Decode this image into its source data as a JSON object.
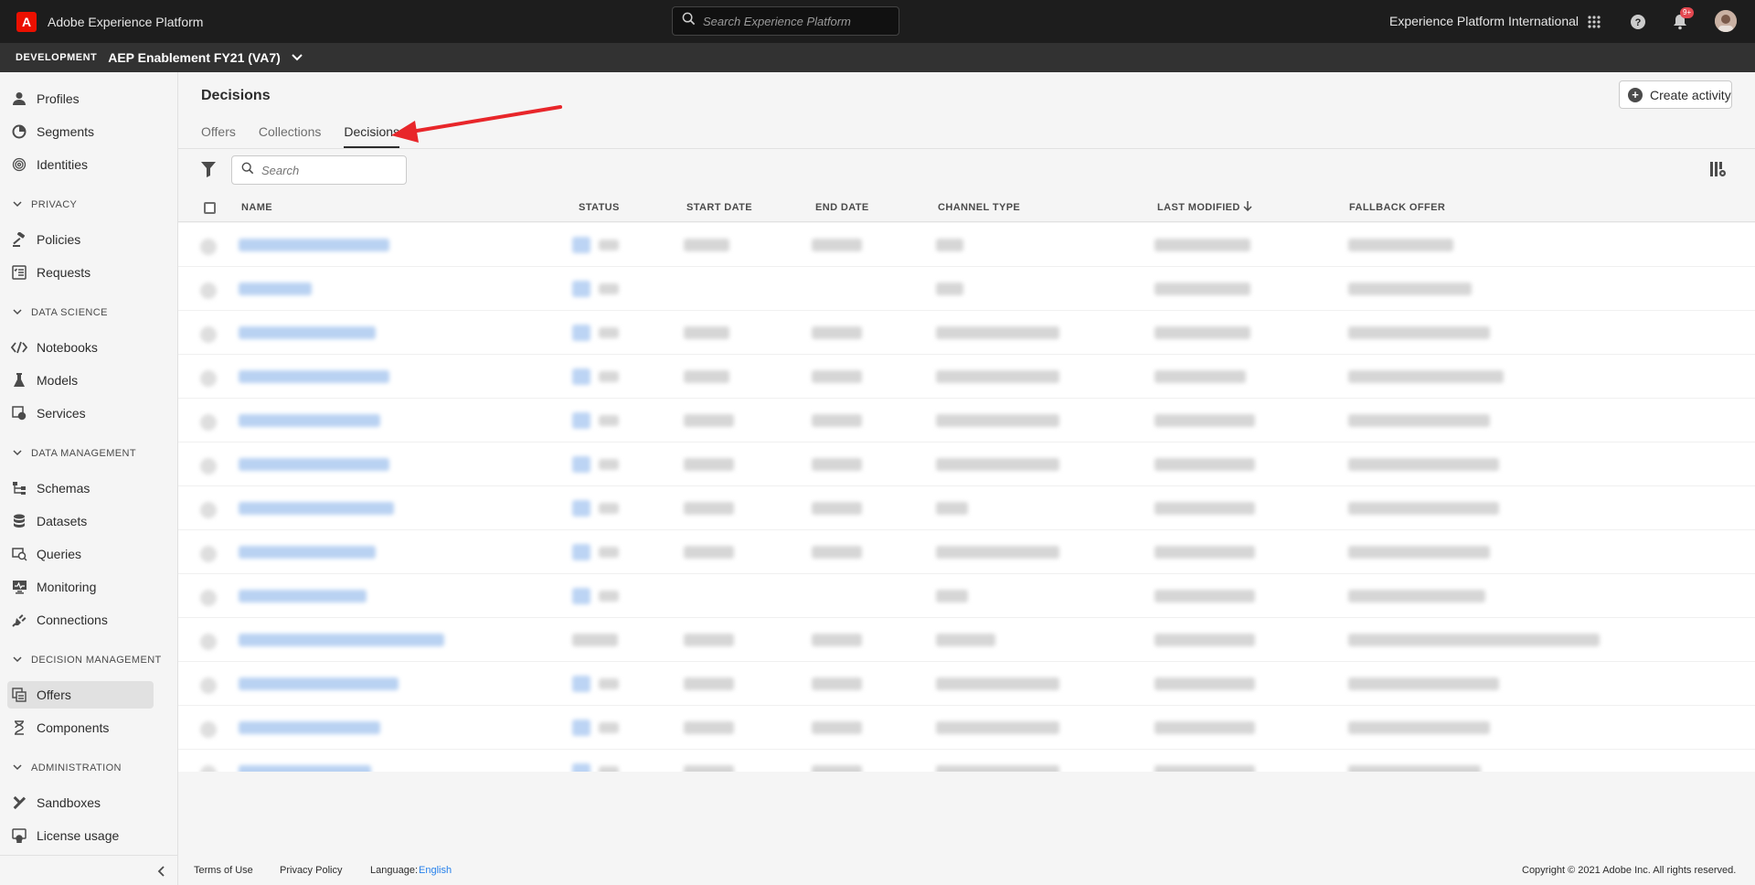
{
  "topbar": {
    "app_title": "Adobe Experience Platform",
    "search_placeholder": "Search Experience Platform",
    "org_name": "Experience Platform International",
    "notification_count": "9+"
  },
  "sandbox": {
    "env_label": "DEVELOPMENT",
    "name": "AEP Enablement FY21 (VA7)"
  },
  "sidebar": {
    "items": [
      {
        "label": "Profiles",
        "icon": "person-icon"
      },
      {
        "label": "Segments",
        "icon": "segments-icon"
      },
      {
        "label": "Identities",
        "icon": "fingerprint-icon"
      },
      {
        "label": "Policies",
        "icon": "gavel-icon"
      },
      {
        "label": "Requests",
        "icon": "checklist-icon"
      },
      {
        "label": "Notebooks",
        "icon": "code-icon"
      },
      {
        "label": "Models",
        "icon": "flask-icon"
      },
      {
        "label": "Services",
        "icon": "gear-box-icon"
      },
      {
        "label": "Schemas",
        "icon": "schema-icon"
      },
      {
        "label": "Datasets",
        "icon": "database-icon"
      },
      {
        "label": "Queries",
        "icon": "query-icon"
      },
      {
        "label": "Monitoring",
        "icon": "monitor-icon"
      },
      {
        "label": "Connections",
        "icon": "plug-icon"
      },
      {
        "label": "Offers",
        "icon": "offers-icon"
      },
      {
        "label": "Components",
        "icon": "components-icon"
      },
      {
        "label": "Sandboxes",
        "icon": "tools-icon"
      },
      {
        "label": "License usage",
        "icon": "license-icon"
      }
    ],
    "sections": [
      "PRIVACY",
      "DATA SCIENCE",
      "DATA MANAGEMENT",
      "DECISION MANAGEMENT",
      "ADMINISTRATION"
    ]
  },
  "main": {
    "title": "Decisions",
    "create_button": "Create activity",
    "tabs": [
      "Offers",
      "Collections",
      "Decisions"
    ],
    "active_tab": "Decisions",
    "search_placeholder": "Search",
    "columns": [
      "NAME",
      "STATUS",
      "START DATE",
      "END DATE",
      "CHANNEL TYPE",
      "LAST MODIFIED",
      "FALLBACK OFFER"
    ]
  },
  "footer": {
    "terms": "Terms of Use",
    "privacy": "Privacy Policy",
    "language_label": "Language:",
    "language_value": "English",
    "copyright": "Copyright ©  2021 Adobe Inc.  All rights reserved."
  },
  "colors": {
    "topbar_bg": "#1d1d1d",
    "sandbox_bg": "#323232",
    "adobe_red": "#eb1000",
    "link_blue": "#2680eb",
    "annotation_red": "#e8262a"
  }
}
